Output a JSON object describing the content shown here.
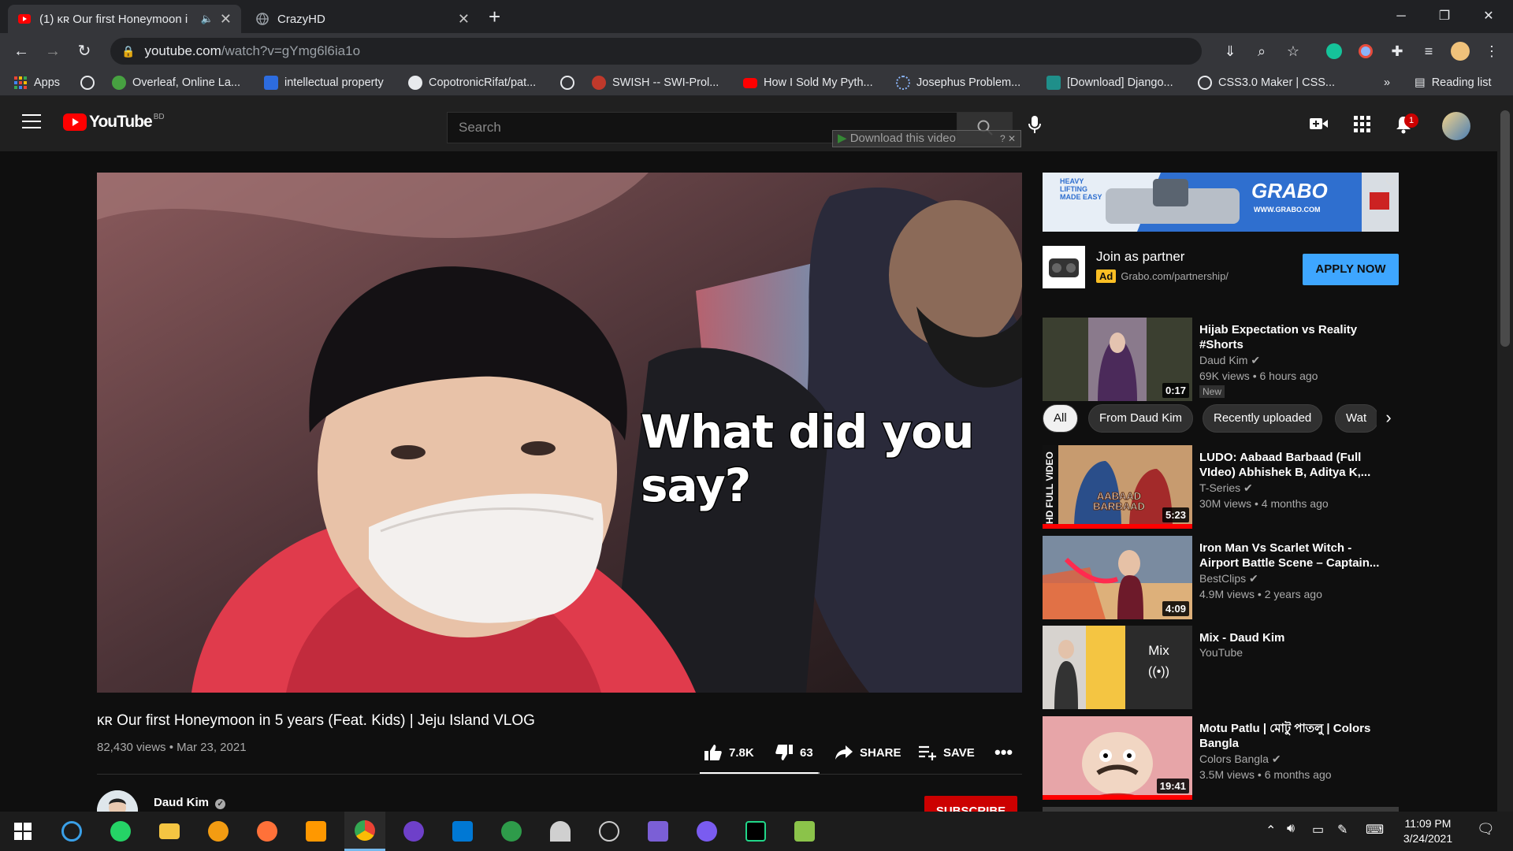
{
  "browser": {
    "tabs": [
      {
        "title": "(1) ᴋʀ Our first Honeymoon i",
        "active": true
      },
      {
        "title": "CrazyHD",
        "active": false
      }
    ],
    "new_tab": "+",
    "url_host": "youtube.com",
    "url_path": "/watch?v=gYmg6l6ia1o",
    "bookmarks": [
      "Apps",
      "",
      "Overleaf, Online La...",
      "intellectual property",
      "CopotronicRifat/pat...",
      "",
      "SWISH -- SWI-Prol...",
      "How I Sold My Pyth...",
      "Josephus Problem...",
      "[Download] Django...",
      "CSS3.0 Maker | CSS..."
    ],
    "more_bookmarks": "»",
    "reading_list": "Reading list"
  },
  "youtube": {
    "logo_text": "YouTube",
    "country": "BD",
    "search_placeholder": "Search",
    "download_overlay": "Download this video",
    "notification_count": "1",
    "video": {
      "caption": "What did you say?",
      "title": "ᴋʀ Our first Honeymoon in 5 years (Feat. Kids) | Jeju Island VLOG",
      "views": "82,430 views",
      "date": "Mar 23, 2021",
      "likes": "7.8K",
      "dislikes": "63",
      "share_label": "SHARE",
      "save_label": "SAVE",
      "like_ratio": 0.99
    },
    "channel": {
      "name": "Daud Kim",
      "subscribe_label": "SUBSCRIBE"
    },
    "ad": {
      "banner_tagline": "HEAVY LIFTING MADE EASY",
      "banner_brand": "GRABO",
      "banner_url": "WWW.GRABO.COM",
      "title": "Join as partner",
      "badge": "Ad",
      "url": "Grabo.com/partnership/",
      "cta": "APPLY NOW"
    },
    "chips": [
      "All",
      "From Daud Kim",
      "Recently uploaded",
      "Wat"
    ],
    "recommendations": [
      {
        "title": "Hijab Expectation vs Reality #Shorts",
        "channel": "Daud Kim",
        "verified": true,
        "meta": "69K views • 6 hours ago",
        "badge": "New",
        "duration": "0:17"
      },
      {
        "title": "LUDO: Aabaad Barbaad (Full VIdeo) Abhishek B, Aditya K,...",
        "channel": "T-Series",
        "verified": true,
        "meta": "30M views • 4 months ago",
        "duration": "5:23",
        "thumb_text": "AABAAD BARBAAD",
        "side_text": "HD FULL VIDEO"
      },
      {
        "title": "Iron Man Vs Scarlet Witch - Airport Battle Scene – Captain...",
        "channel": "BestClips",
        "verified": true,
        "meta": "4.9M views • 2 years ago",
        "duration": "4:09"
      },
      {
        "title": "Mix - Daud Kim",
        "channel": "YouTube",
        "verified": false,
        "meta": "",
        "duration": "",
        "overlay": "Mix"
      },
      {
        "title": "Motu Patlu | মোটু পাতলু | Colors Bangla",
        "channel": "Colors Bangla",
        "verified": true,
        "meta": "3.5M views • 6 months ago",
        "duration": "19:41"
      }
    ]
  },
  "taskbar": {
    "time": "11:09 PM",
    "date": "3/24/2021"
  },
  "colors": {
    "brand_red": "#ff0000",
    "subscribe": "#cc0000",
    "apply": "#3ea6ff",
    "background": "#0f0f0f"
  }
}
